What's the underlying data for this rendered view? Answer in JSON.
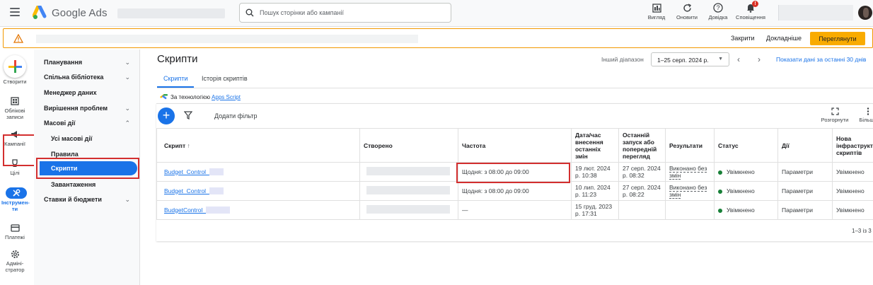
{
  "app": {
    "name": "Google Ads"
  },
  "search": {
    "placeholder": "Пошук сторінки або кампанії"
  },
  "toolbar": [
    {
      "label": "Вигляд",
      "icon": "view-icon"
    },
    {
      "label": "Оновити",
      "icon": "refresh-icon"
    },
    {
      "label": "Довідка",
      "icon": "help-icon"
    },
    {
      "label": "Сповіщення",
      "icon": "bell-icon",
      "badge": "!"
    }
  ],
  "notification": {
    "close": "Закрити",
    "details": "Докладніше",
    "review": "Переглянути"
  },
  "rail": {
    "create": "Створити",
    "accounts": "Облікові записи",
    "campaigns": "Кампанії",
    "goals": "Цілі",
    "tools": "Інструмен-ти",
    "billing": "Платежі",
    "admin": "Адміні-стратор"
  },
  "sidenav": {
    "planning": "Планування",
    "shared_library": "Спільна бібліотека",
    "data_manager": "Менеджер даних",
    "troubleshooting": "Вирішення проблем",
    "bulk_actions": "Масові дії",
    "all_bulk_actions": "Усі масові дії",
    "rules": "Правила",
    "scripts": "Скрипти",
    "uploads": "Завантаження",
    "bids_budgets": "Ставки й бюджети"
  },
  "page": {
    "title": "Скрипти",
    "range_label": "Інший діапазон",
    "range_value": "1–25 серп. 2024 р.",
    "show_last": "Показати дані за останні 30 днів",
    "tabs": [
      "Скрипти",
      "Історія скриптів"
    ],
    "apps_script_prefix": "За технологією",
    "apps_script_link": "Apps Script",
    "add_filter": "Додати фільтр",
    "expand": "Розгорнути",
    "more": "Більше",
    "pager": "1–3 із 3"
  },
  "table": {
    "headers": {
      "script": "Скрипт",
      "created": "Створено",
      "frequency": "Частота",
      "modified": "Дата/час внесення останніх змін",
      "last_run": "Останній запуск або попередній перегляд",
      "results": "Результати",
      "status": "Статус",
      "actions": "Дії",
      "new_infra": "Нова інфраструктура скриптів"
    },
    "rows": [
      {
        "name": "Budget_Control_",
        "frequency": "Щодня: з 08:00 до 09:00",
        "modified": "19 лют. 2024 р. 10:38",
        "last_run": "27 серп. 2024 р. 08:32",
        "results": "Виконано без змін",
        "status": "Увімкнено",
        "actions": "Параметри",
        "new_infra": "Увімкнено"
      },
      {
        "name": "Budget_Control_",
        "frequency": "Щодня: з 08:00 до 09:00",
        "modified": "10 лип. 2024 р. 11:23",
        "last_run": "27 серп. 2024 р. 08:22",
        "results": "Виконано без змін",
        "status": "Увімкнено",
        "actions": "Параметри",
        "new_infra": "Увімкнено"
      },
      {
        "name": "BudgetControl_",
        "frequency": "—",
        "modified": "15 груд. 2023 р. 17:31",
        "last_run": "",
        "results": "",
        "status": "Увімкнено",
        "actions": "Параметри",
        "new_infra": "Увімкнено"
      }
    ]
  },
  "colors": {
    "primary": "#1a73e8",
    "warning": "#f9ab00",
    "highlight": "#d32f2f",
    "status_on": "#188038"
  }
}
